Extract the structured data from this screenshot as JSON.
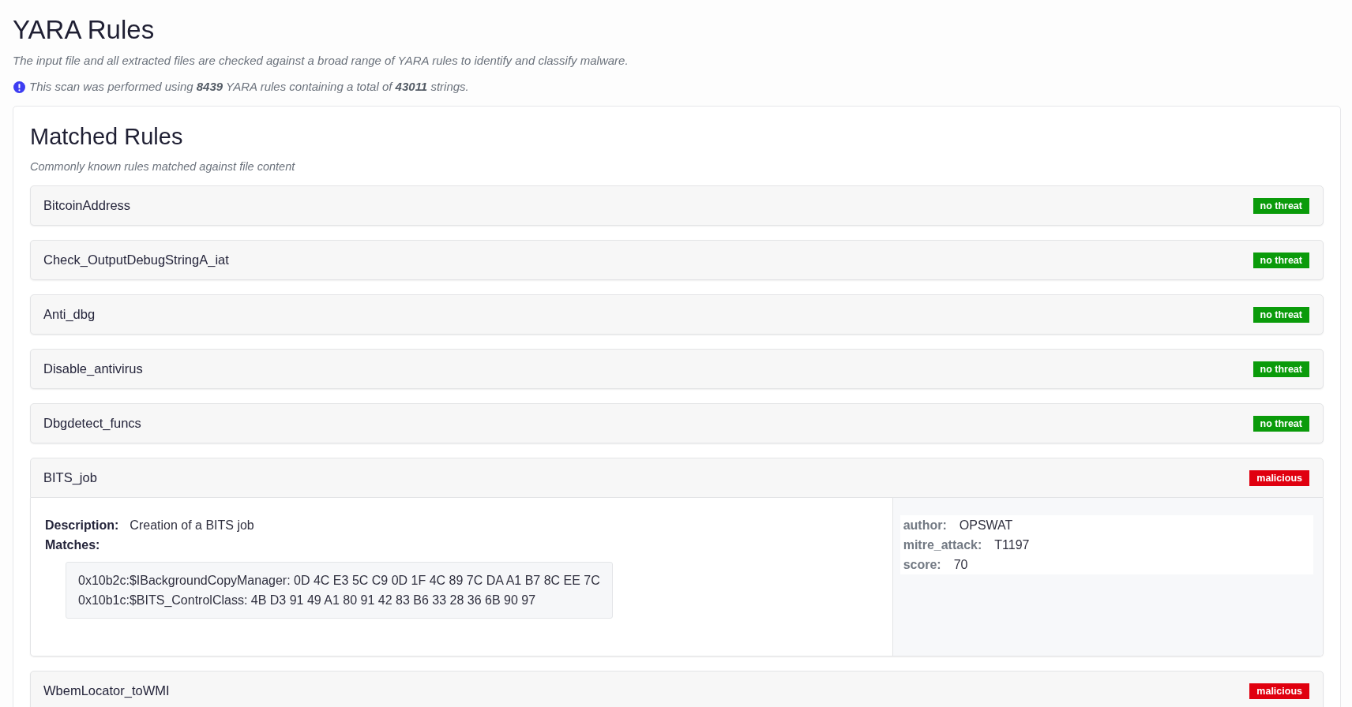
{
  "page": {
    "title": "YARA Rules",
    "description": "The input file and all extracted files are checked against a broad range of YARA rules to identify and classify malware.",
    "scan_info": "This scan was performed using **8439** YARA rules containing a total of **43011** strings."
  },
  "matched_rules": {
    "title": "Matched Rules",
    "subtitle": "Commonly known rules matched against file content",
    "rules": [
      {
        "name": "BitcoinAddress",
        "expanded": false,
        "badge": {
          "text": "no threat",
          "color": "#0a9b0a"
        }
      },
      {
        "name": "Check_OutputDebugStringA_iat",
        "expanded": false,
        "badge": {
          "text": "no threat",
          "color": "#0a9b0a"
        }
      },
      {
        "name": "Anti_dbg",
        "expanded": false,
        "badge": {
          "text": "no threat",
          "color": "#0a9b0a"
        }
      },
      {
        "name": "Disable_antivirus",
        "expanded": false,
        "badge": {
          "text": "no threat",
          "color": "#0a9b0a"
        }
      },
      {
        "name": "Dbgdetect_funcs",
        "expanded": false,
        "badge": {
          "text": "no threat",
          "color": "#0a9b0a"
        }
      },
      {
        "name": "BITS_job",
        "expanded": true,
        "badge": {
          "text": "malicious",
          "color": "#e0000f"
        },
        "description": {
          "label": "Description:",
          "value": "Creation of a BITS job"
        },
        "matches": {
          "label": "Matches:",
          "lines": [
            "0x10b2c:$IBackgroundCopyManager: 0D 4C E3 5C C9 0D 1F 4C 89 7C DA A1 B7 8C EE 7C",
            "0x10b1c:$BITS_ControlClass: 4B D3 91 49 A1 80 91 42 83 B6 33 28 36 6B 90 97"
          ]
        },
        "metadata": [
          {
            "key": "author:",
            "value": "OPSWAT"
          },
          {
            "key": "mitre_attack:",
            "value": "T1197"
          },
          {
            "key": "score:",
            "value": "70"
          }
        ]
      },
      {
        "name": "WbemLocator_toWMI",
        "expanded": false,
        "badge": {
          "text": "malicious",
          "color": "#e0000f"
        }
      }
    ]
  }
}
